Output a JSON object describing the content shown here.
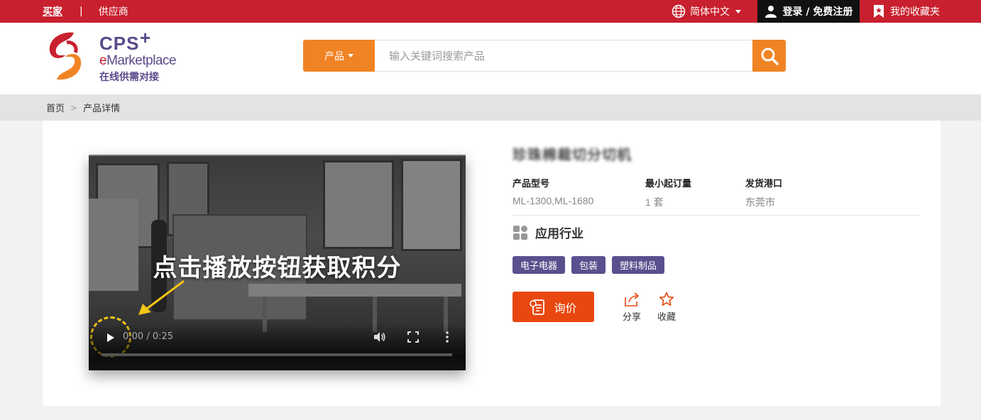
{
  "topbar": {
    "buyer": "买家",
    "separator": "|",
    "supplier": "供应商",
    "language": "简体中文",
    "login": "登录 / 免费注册",
    "favorites": "我的收藏夹"
  },
  "logo": {
    "line1": "CPS",
    "plus": "+",
    "line2_e": "e",
    "line2_rest": "Marketplace",
    "line3": "在线供需对接"
  },
  "search": {
    "category": "产品",
    "placeholder": "输入关键词搜索产品",
    "value": ""
  },
  "breadcrumb": {
    "home": "首页",
    "chevron": ">",
    "current": "产品详情"
  },
  "video": {
    "overlay_text": "点击播放按钮获取积分",
    "time": "0:00 / 0:25",
    "progress": 0
  },
  "product": {
    "title": "珍珠棉裁切分切机",
    "specs": [
      {
        "key": "产品型号",
        "value": "ML-1300,ML-1680"
      },
      {
        "key": "最小起订量",
        "value": "1 套"
      },
      {
        "key": "发货港口",
        "value": "东莞市"
      }
    ],
    "industry_label": "应用行业",
    "tags": [
      "电子电器",
      "包装",
      "塑料制品"
    ],
    "inquire_label": "询价",
    "share_label": "分享",
    "collect_label": "收藏"
  },
  "colors": {
    "brand_red": "#c8202e",
    "accent_orange": "#f08424",
    "inquire_orange": "#e8470f",
    "tag_purple": "#5b4f8e"
  }
}
